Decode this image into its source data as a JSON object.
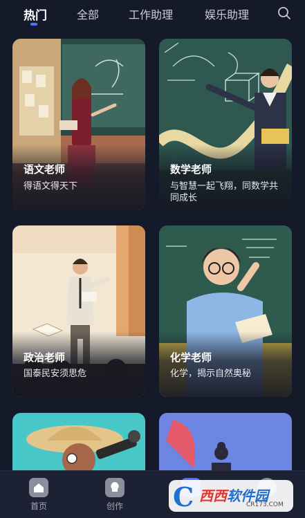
{
  "tabs": [
    {
      "label": "热门",
      "active": true
    },
    {
      "label": "全部",
      "active": false
    },
    {
      "label": "工作助理",
      "active": false
    },
    {
      "label": "娱乐助理",
      "active": false
    }
  ],
  "search_icon": "search-icon",
  "cards": [
    {
      "title": "语文老师",
      "desc": "得语文得天下"
    },
    {
      "title": "数学老师",
      "desc": "与智慧一起飞翔，同数学共同成长"
    },
    {
      "title": "政治老师",
      "desc": "国泰民安须思危"
    },
    {
      "title": "化学老师",
      "desc": "化学，揭示自然奥秘"
    },
    {
      "title": "",
      "desc": ""
    },
    {
      "title": "",
      "desc": ""
    }
  ],
  "bottom_nav": [
    {
      "label": "首页",
      "icon": "home-icon"
    },
    {
      "label": "创作",
      "icon": "create-icon"
    },
    {
      "label": "",
      "icon": "discover-icon"
    },
    {
      "label": "",
      "icon": "profile-icon"
    }
  ],
  "watermark": {
    "brand_a": "西西",
    "brand_b": "软件园",
    "url": "CR173.COM"
  },
  "colors": {
    "background": "#151a2b",
    "accent": "#4b73ff",
    "nav_background": "#1c2134"
  }
}
